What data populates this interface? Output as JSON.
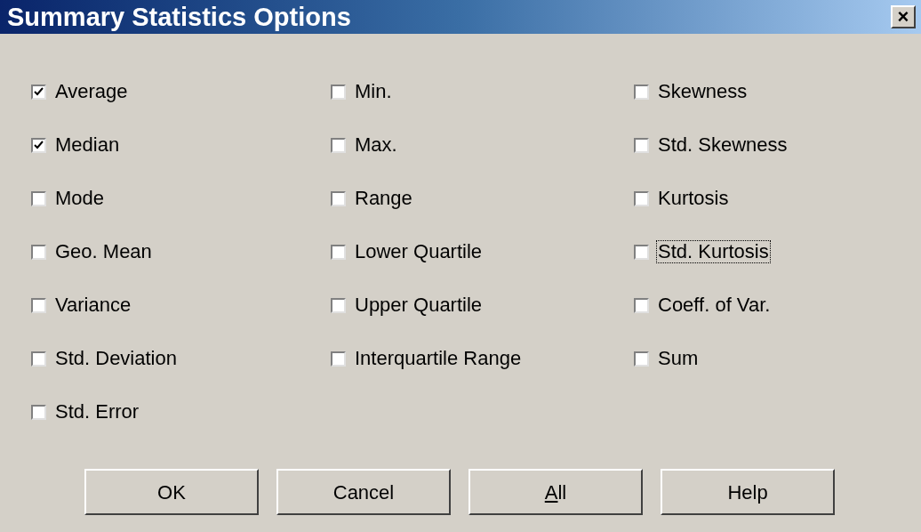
{
  "window": {
    "title": "Summary Statistics Options",
    "close": "×"
  },
  "columns": [
    [
      {
        "label": "Average",
        "checked": true,
        "focused": false
      },
      {
        "label": "Median",
        "checked": true,
        "focused": false
      },
      {
        "label": "Mode",
        "checked": false,
        "focused": false
      },
      {
        "label": "Geo. Mean",
        "checked": false,
        "focused": false
      },
      {
        "label": "Variance",
        "checked": false,
        "focused": false
      },
      {
        "label": "Std. Deviation",
        "checked": false,
        "focused": false
      },
      {
        "label": "Std. Error",
        "checked": false,
        "focused": false
      }
    ],
    [
      {
        "label": "Min.",
        "checked": false,
        "focused": false
      },
      {
        "label": "Max.",
        "checked": false,
        "focused": false
      },
      {
        "label": "Range",
        "checked": false,
        "focused": false
      },
      {
        "label": "Lower Quartile",
        "checked": false,
        "focused": false
      },
      {
        "label": "Upper Quartile",
        "checked": false,
        "focused": false
      },
      {
        "label": "Interquartile Range",
        "checked": false,
        "focused": false
      }
    ],
    [
      {
        "label": "Skewness",
        "checked": false,
        "focused": false
      },
      {
        "label": "Std. Skewness",
        "checked": false,
        "focused": false
      },
      {
        "label": "Kurtosis",
        "checked": false,
        "focused": false
      },
      {
        "label": "Std. Kurtosis",
        "checked": false,
        "focused": true
      },
      {
        "label": "Coeff. of Var.",
        "checked": false,
        "focused": false
      },
      {
        "label": "Sum",
        "checked": false,
        "focused": false
      }
    ]
  ],
  "buttons": [
    {
      "label": "OK",
      "first_letter_underlined": false
    },
    {
      "label": "Cancel",
      "first_letter_underlined": false
    },
    {
      "label": "All",
      "first_letter_underlined": true
    },
    {
      "label": "Help",
      "first_letter_underlined": false
    }
  ]
}
